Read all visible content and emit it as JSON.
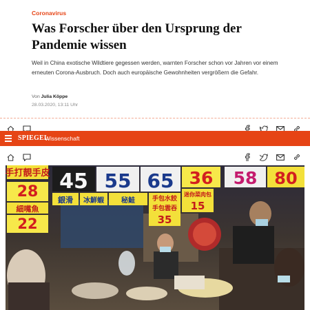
{
  "article": {
    "kicker": "Coronavirus",
    "headline": "Was Forscher über den Ursprung der Pandemie wissen",
    "teaser": "Weil in China exotische Wildtiere gegessen werden, warnten Forscher schon vor Jahren vor einem erneuten Corona-Ausbruch. Doch auch europäische Gewohnheiten vergrößern die Gefahr.",
    "byline_prefix": "Von",
    "author": "Julia Köppe",
    "date": "28.03.2020, 13:11 Uhr"
  },
  "navbar": {
    "logo": "SPIEGEL",
    "section": "Wissenschaft",
    "color": "#e64415"
  },
  "toolbar_icons": [
    "home-icon",
    "comment-icon",
    "facebook-icon",
    "twitter-icon",
    "email-icon",
    "link-icon"
  ],
  "photo": {
    "signs": [
      "手打靚手皮",
      "28",
      "細嘴魚",
      "22",
      "45",
      "銀滑",
      "55",
      "秘鮭",
      "冰鮮蝦",
      "65",
      "手包水餃",
      "手包雲吞",
      "35",
      "36",
      "58",
      "迷你菜肉包",
      "15",
      "80"
    ]
  }
}
